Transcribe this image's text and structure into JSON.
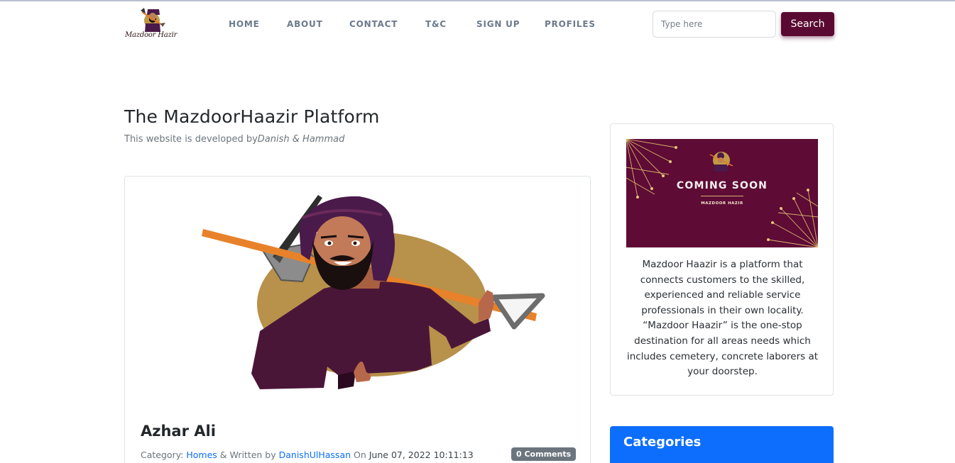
{
  "brand": {
    "name": "Mazdoor Hazir"
  },
  "nav": {
    "items": [
      {
        "label": "HOME"
      },
      {
        "label": "ABOUT"
      },
      {
        "label": "CONTACT"
      },
      {
        "label": "T&C"
      },
      {
        "label": "SIGN UP"
      },
      {
        "label": "PROFILES"
      }
    ]
  },
  "search": {
    "placeholder": "Type here",
    "button_label": "Search"
  },
  "main": {
    "title": "The MazdoorHaazir Platform",
    "subtitle_prefix": "This website is developed by",
    "subtitle_authors": "Danish & Hammad"
  },
  "post": {
    "title": "Azhar Ali",
    "category_prefix": "Category: ",
    "category": "Homes",
    "written_by_prefix": " & Written by ",
    "author": "DanishUlHassan",
    "on_prefix": " On ",
    "datetime": "June 07, 2022 10:11:13",
    "comments_badge": "0 Comments"
  },
  "sidebar": {
    "promo": {
      "title": "COMING SOON",
      "subtitle": "MAZDOOR HAZIR"
    },
    "description": "Mazdoor Haazir is a platform that connects customers to the skilled, experienced and reliable service professionals in their own locality. “Mazdoor Haazir” is the one-stop destination for all areas needs which includes cemetery, concrete laborers at your doorstep.",
    "categories_title": "Categories"
  },
  "colors": {
    "brand_primary": "#5a0a32",
    "accent_blue": "#0d6efd",
    "nav_text": "#6c7a8c",
    "badge_gray": "#6c757d"
  }
}
